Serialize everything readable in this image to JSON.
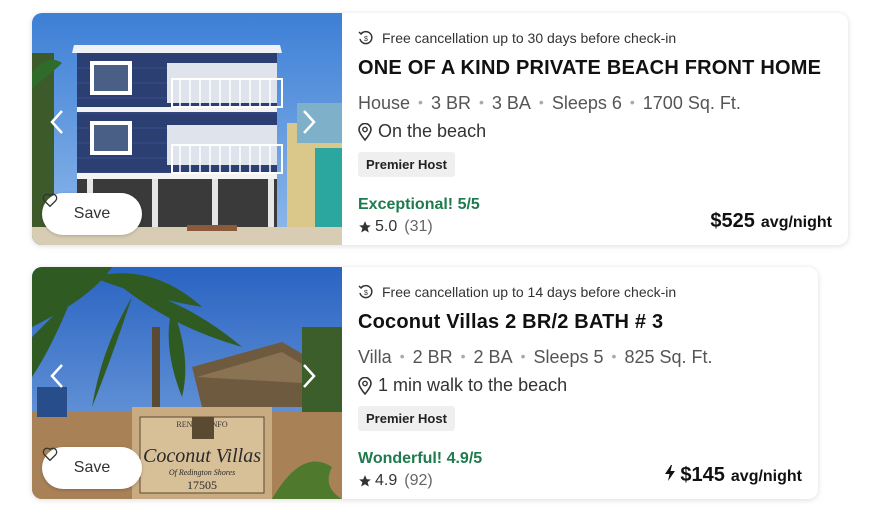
{
  "listings": [
    {
      "cancellation": "Free cancellation up to 30 days before check-in",
      "title": "ONE OF A KIND PRIVATE BEACH FRONT HOME",
      "type": "House",
      "bedrooms": "3 BR",
      "bathrooms": "3 BA",
      "sleeps": "Sleeps 6",
      "area": "1700 Sq. Ft.",
      "location": "On the beach",
      "badge": "Premier Host",
      "rating_text": "Exceptional! 5/5",
      "stars": "5.0",
      "reviews": "(31)",
      "price": "$525",
      "per_night": "avg/night",
      "save_label": "Save"
    },
    {
      "cancellation": "Free cancellation up to 14 days before check-in",
      "title": "Coconut Villas 2 BR/2 BATH # 3",
      "type": "Villa",
      "bedrooms": "2 BR",
      "bathrooms": "2 BA",
      "sleeps": "Sleeps 5",
      "area": "825 Sq. Ft.",
      "location": "1 min walk to the beach",
      "badge": "Premier Host",
      "rating_text": "Wonderful! 4.9/5",
      "stars": "4.9",
      "reviews": "(92)",
      "price": "$145",
      "per_night": "avg/night",
      "save_label": "Save",
      "sign_text": "RENTAL INFO",
      "sign_name": "Coconut Villas",
      "sign_sub": "Of Redington Shores",
      "sign_number": "17505"
    }
  ],
  "icons": {
    "cancel": "calendar-refresh-icon",
    "location": "location-pin-icon",
    "star": "star-icon",
    "heart": "heart-icon",
    "bolt": "lightning-icon"
  },
  "colors": {
    "rating_green": "#1f7a4d"
  }
}
